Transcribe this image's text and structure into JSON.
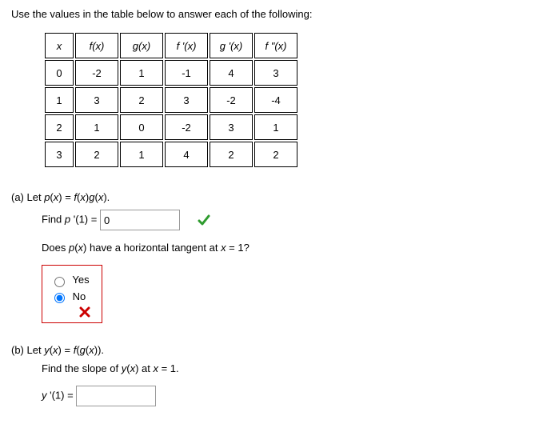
{
  "instruction": "Use the values in the table below to answer each of the following:",
  "table": {
    "headers": [
      "x",
      "f(x)",
      "g(x)",
      "f '(x)",
      "g '(x)",
      "f \"(x)"
    ],
    "rows": [
      [
        "0",
        "-2",
        "1",
        "-1",
        "4",
        "3"
      ],
      [
        "1",
        "3",
        "2",
        "3",
        "-2",
        "-4"
      ],
      [
        "2",
        "1",
        "0",
        "-2",
        "3",
        "1"
      ],
      [
        "3",
        "2",
        "1",
        "4",
        "2",
        "2"
      ]
    ]
  },
  "partA": {
    "label": "(a) Let p(x) = f(x)g(x).",
    "find_label_prefix": "Find ",
    "find_label_expr": "p '(1) = ",
    "answer_value": "0",
    "question2": "Does p(x) have a horizontal tangent at x = 1?",
    "opt_yes": "Yes",
    "opt_no": "No"
  },
  "partB": {
    "label": "(b) Let y(x) = f(g(x)).",
    "slope_label": "Find the slope of y(x) at x = 1.",
    "expr": "y '(1) = ",
    "answer_value": ""
  },
  "chart_data": {
    "type": "table",
    "columns": [
      "x",
      "f(x)",
      "g(x)",
      "f'(x)",
      "g'(x)",
      "f''(x)"
    ],
    "rows": [
      {
        "x": 0,
        "f(x)": -2,
        "g(x)": 1,
        "f'(x)": -1,
        "g'(x)": 4,
        "f''(x)": 3
      },
      {
        "x": 1,
        "f(x)": 3,
        "g(x)": 2,
        "f'(x)": 3,
        "g'(x)": -2,
        "f''(x)": -4
      },
      {
        "x": 2,
        "f(x)": 1,
        "g(x)": 0,
        "f'(x)": -2,
        "g'(x)": 3,
        "f''(x)": 1
      },
      {
        "x": 3,
        "f(x)": 2,
        "g(x)": 1,
        "f'(x)": 4,
        "g'(x)": 2,
        "f''(x)": 2
      }
    ]
  }
}
